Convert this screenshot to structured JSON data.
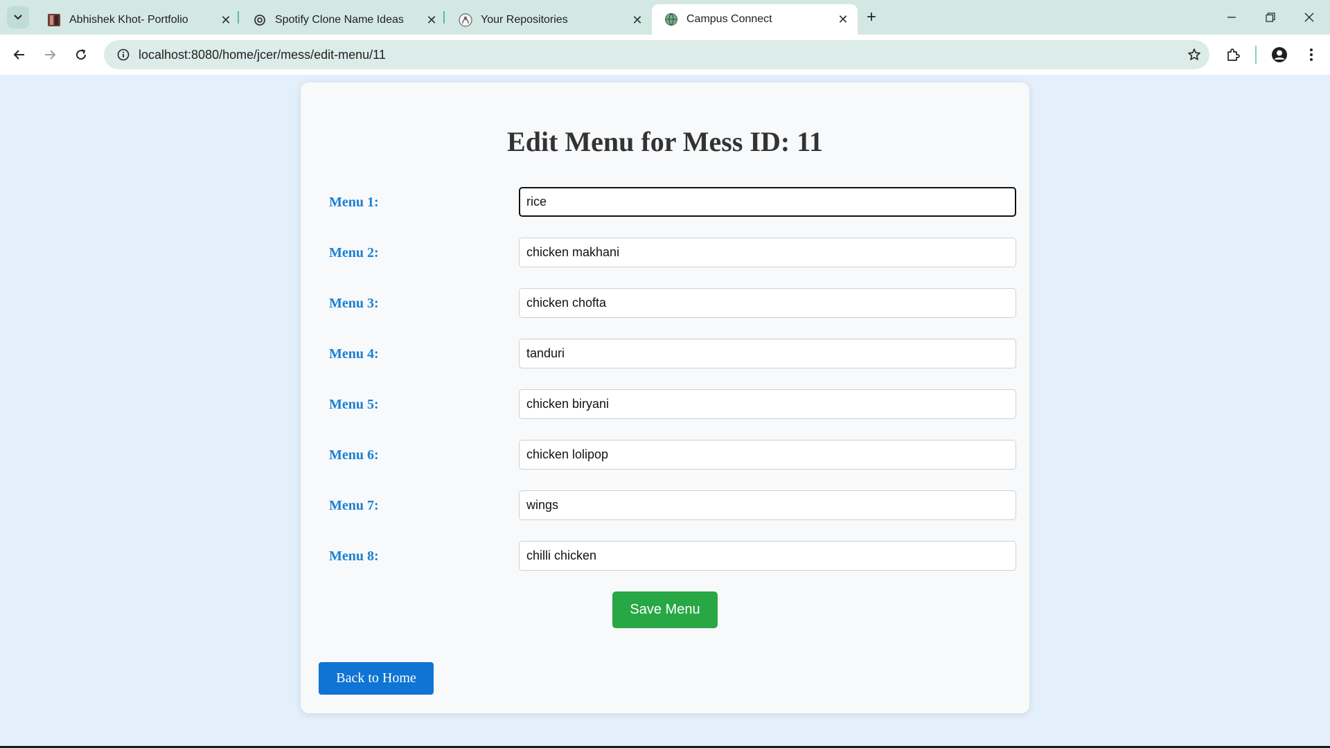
{
  "browser": {
    "tabs": [
      {
        "title": "Abhishek Khot- Portfolio",
        "icon": "portfolio-favicon"
      },
      {
        "title": "Spotify Clone Name Ideas",
        "icon": "openai-favicon"
      },
      {
        "title": "Your Repositories",
        "icon": "github-favicon"
      },
      {
        "title": "Campus Connect",
        "icon": "globe-favicon",
        "active": true
      }
    ],
    "close_glyph": "✕",
    "new_tab_glyph": "+",
    "url": "localhost:8080/home/jcer/mess/edit-menu/11"
  },
  "page": {
    "title": "Edit Menu for Mess ID: 11",
    "menus": [
      {
        "label": "Menu 1:",
        "value": "rice"
      },
      {
        "label": "Menu 2:",
        "value": "chicken makhani"
      },
      {
        "label": "Menu 3:",
        "value": "chicken chofta"
      },
      {
        "label": "Menu 4:",
        "value": "tanduri"
      },
      {
        "label": "Menu 5:",
        "value": "chicken biryani"
      },
      {
        "label": "Menu 6:",
        "value": "chicken lolipop"
      },
      {
        "label": "Menu 7:",
        "value": "wings"
      },
      {
        "label": "Menu 8:",
        "value": "chilli chicken"
      }
    ],
    "save_label": "Save Menu",
    "back_label": "Back to Home"
  },
  "colors": {
    "page_bg": "#e3effa",
    "label": "#1a7fd3",
    "save_button": "#28a745",
    "back_button": "#0f74d3",
    "tabstrip": "#d3e8e3"
  }
}
